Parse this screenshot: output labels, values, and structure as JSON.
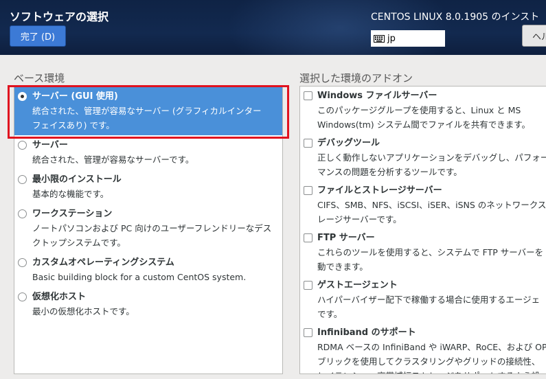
{
  "header": {
    "title": "ソフトウェアの選択",
    "done_label": "完了 (D)",
    "product": "CENTOS LINUX 8.0.1905 のインスト",
    "keyboard_layout": "jp",
    "help_label": "ヘル"
  },
  "base_env": {
    "title": "ベース環境",
    "items": [
      {
        "name": "サーバー (GUI 使用)",
        "desc1": "統合された、管理が容易なサーバー (グラフィカルインター",
        "desc2": "フェイスあり) です。"
      },
      {
        "name": "サーバー",
        "desc1": "統合された、管理が容易なサーバーです。"
      },
      {
        "name": "最小限のインストール",
        "desc1": "基本的な機能です。"
      },
      {
        "name": "ワークステーション",
        "desc1": "ノートパソコンおよび PC 向けのユーザーフレンドリーなデス",
        "desc2": "クトップシステムです。"
      },
      {
        "name": "カスタムオペレーティングシステム",
        "desc1": "Basic building block for a custom CentOS system."
      },
      {
        "name": "仮想化ホスト",
        "desc1": "最小の仮想化ホストです。"
      }
    ]
  },
  "addons": {
    "title": "選択した環境のアドオン",
    "items": [
      {
        "name": "Windows ファイルサーバー",
        "desc1": "このパッケージグループを使用すると、Linux と MS",
        "desc2": "Windows(tm) システム間でファイルを共有できます。"
      },
      {
        "name": "デバッグツール",
        "desc1": "正しく動作しないアプリケーションをデバッグし、パフォー",
        "desc2": "マンスの問題を分析するツールです。"
      },
      {
        "name": "ファイルとストレージサーバー",
        "desc1": "CIFS、SMB、NFS、iSCSI、iSER、iSNS のネットワークス",
        "desc2": "レージサーバーです。"
      },
      {
        "name": "FTP サーバー",
        "desc1": "これらのツールを使用すると、システムで FTP サーバーを",
        "desc2": "動できます。"
      },
      {
        "name": "ゲストエージェント",
        "desc1": "ハイパーバイザー配下で稼働する場合に使用するエージェ",
        "desc2": "です。"
      },
      {
        "name": "Infiniband のサポート",
        "desc1": "RDMA ベースの InfiniBand や iWARP、RoCE、および OPA",
        "desc2": "ブリックを使用してクラスタリングやグリッドの接続性、",
        "desc3": "レイテンシー、高帯域幅ストレージをサポートするよう設"
      }
    ]
  }
}
